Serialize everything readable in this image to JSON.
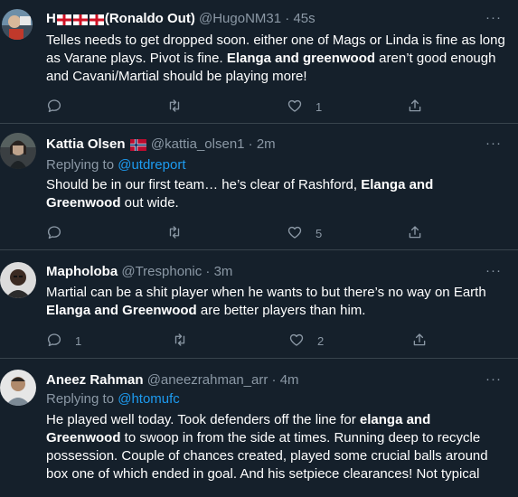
{
  "tweets": [
    {
      "name": "H",
      "name_suffix": "(Ronaldo Out)",
      "handle": "@HugoNM31",
      "time": "45s",
      "more": "···",
      "body": [
        {
          "t": "Telles needs to get dropped soon. either one of Mags or Linda is fine as long as Varane plays. Pivot is fine. "
        },
        {
          "t": "Elanga and greenwood",
          "b": true
        },
        {
          "t": " aren’t good enough and Cavani/Martial should be playing more!"
        }
      ],
      "reply_count": "",
      "retweet_count": "",
      "like_count": "1"
    },
    {
      "name": "Kattia Olsen",
      "handle": "@kattia_olsen1",
      "time": "2m",
      "more": "···",
      "replying_prefix": "Replying to",
      "replying_to": "@utdreport",
      "body": [
        {
          "t": "Should be in our first team… he’s clear of Rashford, "
        },
        {
          "t": "Elanga and Greenwood",
          "b": true
        },
        {
          "t": " out wide."
        }
      ],
      "reply_count": "",
      "retweet_count": "",
      "like_count": "5"
    },
    {
      "name": "Mapholoba",
      "handle": "@Tresphonic",
      "time": "3m",
      "more": "···",
      "body": [
        {
          "t": "Martial can be a shit player when he wants to but there’s no way on Earth "
        },
        {
          "t": "Elanga and Greenwood",
          "b": true
        },
        {
          "t": " are better players than him."
        }
      ],
      "reply_count": "1",
      "retweet_count": "",
      "like_count": "2"
    },
    {
      "name": "Aneez Rahman",
      "handle": "@aneezrahman_arr",
      "time": "4m",
      "more": "···",
      "replying_prefix": "Replying to",
      "replying_to": "@htomufc",
      "body": [
        {
          "t": "He played well today. Took defenders off the line for "
        },
        {
          "t": "elanga and Greenwood",
          "b": true
        },
        {
          "t": " to swoop in from the side at times. Running deep to recycle possession. Couple of chances created, played some crucial balls around box one of which ended in goal. And his setpiece clearances! Not typical"
        }
      ],
      "reply_count": "",
      "retweet_count": "",
      "like_count": ""
    }
  ]
}
